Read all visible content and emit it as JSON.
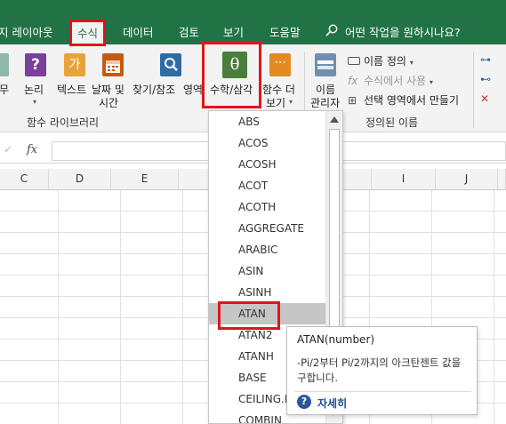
{
  "tabs": {
    "page_layout": "지 레이아웃",
    "formulas": "수식",
    "data": "데이터",
    "review": "검토",
    "view": "보기",
    "help": "도움말",
    "tell_me": "어떤 작업을 원하시나요?"
  },
  "ribbon": {
    "financial_partial": "무",
    "logical": "논리",
    "text": "텍스트",
    "datetime_line1": "날짜 및",
    "datetime_line2": "시간",
    "lookup": "찾기/참조",
    "lookup_partial": "영역",
    "math_trig": "수학/삼각",
    "more_functions_line1": "함수 더",
    "more_functions_line2": "보기",
    "name_manager_line1": "이름",
    "name_manager_line2": "관리자",
    "define_name": "이름 정의",
    "use_in_formula": "수식에서 사용",
    "create_from_selection": "선택 영역에서 만들기",
    "group_function_library": "함수 라이브러리",
    "group_defined_names": "정의된 이름",
    "colors": {
      "green": "#217346",
      "logical_icon": "#7b3f9e",
      "text_icon": "#e8a33d",
      "date_icon": "#c55a11",
      "lookup_icon": "#2e6da4",
      "math_icon": "#4c7e3b",
      "more_icon": "#e38b22"
    }
  },
  "formula_bar": {
    "fx": "fx",
    "value": ""
  },
  "columns": [
    "C",
    "D",
    "E",
    "I",
    "J"
  ],
  "dropdown": {
    "items": [
      "ABS",
      "ACOS",
      "ACOSH",
      "ACOT",
      "ACOTH",
      "AGGREGATE",
      "ARABIC",
      "ASIN",
      "ASINH",
      "ATAN",
      "ATAN2",
      "ATANH",
      "BASE",
      "CEILING.M",
      "COMBIN"
    ],
    "selected": "ATAN"
  },
  "tooltip": {
    "title": "ATAN(number)",
    "description": "-Pi/2부터 Pi/2까지의 아크탄젠트 값을 구합니다.",
    "more": "자세히"
  },
  "highlight_color": "#e0141e"
}
